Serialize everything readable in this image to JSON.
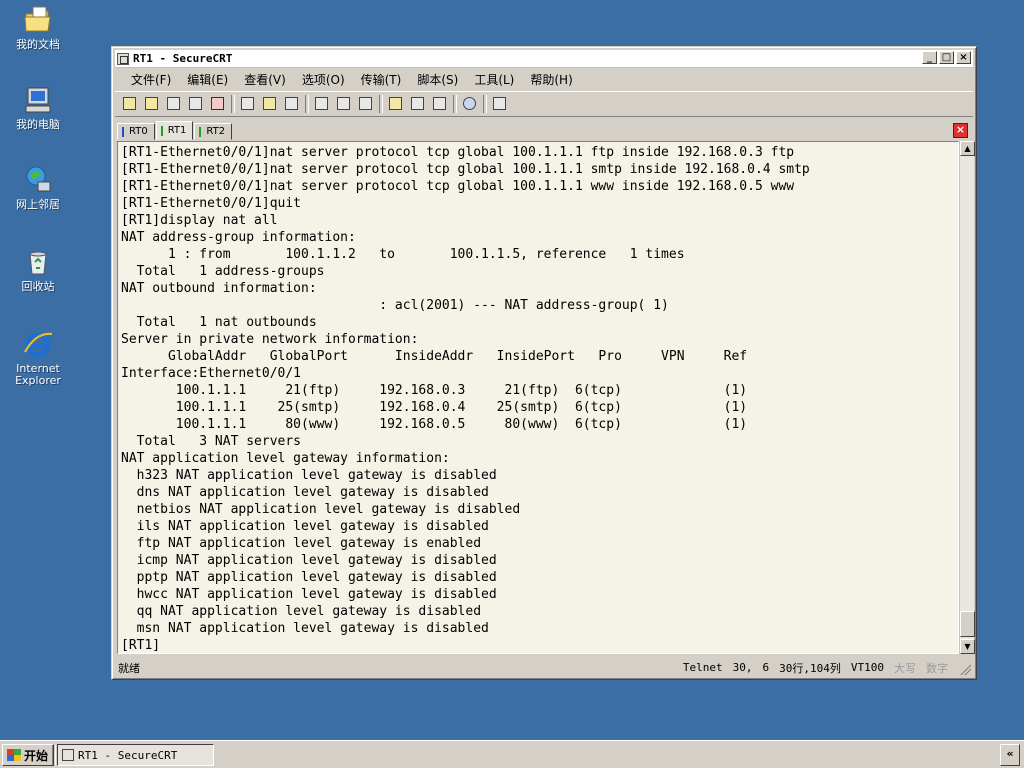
{
  "desktop": {
    "icons": [
      {
        "label": "我的文档",
        "icon": "folder-documents-icon"
      },
      {
        "label": "我的电脑",
        "icon": "computer-icon"
      },
      {
        "label": "网上邻居",
        "icon": "network-icon"
      },
      {
        "label": "回收站",
        "icon": "recycle-bin-icon"
      },
      {
        "label": "Internet Explorer",
        "icon": "internet-explorer-icon"
      }
    ]
  },
  "window": {
    "title": "RT1 - SecureCRT",
    "controls": {
      "minimize": "_",
      "maximize": "□",
      "close": "×"
    },
    "menu": [
      "文件(F)",
      "编辑(E)",
      "查看(V)",
      "选项(O)",
      "传输(T)",
      "脚本(S)",
      "工具(L)",
      "帮助(H)"
    ],
    "tabs": [
      {
        "label": "RT0",
        "color": "#2a4ac0"
      },
      {
        "label": "RT1",
        "color": "#20a020"
      },
      {
        "label": "RT2",
        "color": "#20a020"
      }
    ],
    "active_tab": "RT1",
    "tab_close": "×"
  },
  "terminal": {
    "lines": [
      "[RT1-Ethernet0/0/1]nat server protocol tcp global 100.1.1.1 ftp inside 192.168.0.3 ftp",
      "[RT1-Ethernet0/0/1]nat server protocol tcp global 100.1.1.1 smtp inside 192.168.0.4 smtp",
      "[RT1-Ethernet0/0/1]nat server protocol tcp global 100.1.1.1 www inside 192.168.0.5 www",
      "[RT1-Ethernet0/0/1]quit",
      "[RT1]display nat all",
      "NAT address-group information:",
      "      1 : from       100.1.1.2   to       100.1.1.5, reference   1 times",
      "  Total   1 address-groups",
      "NAT outbound information:",
      "                                 : acl(2001) --- NAT address-group( 1)",
      "  Total   1 nat outbounds",
      "Server in private network information:",
      "      GlobalAddr   GlobalPort      InsideAddr   InsidePort   Pro     VPN     Ref",
      "Interface:Ethernet0/0/1",
      "       100.1.1.1     21(ftp)     192.168.0.3     21(ftp)  6(tcp)             (1)",
      "       100.1.1.1    25(smtp)     192.168.0.4    25(smtp)  6(tcp)             (1)",
      "       100.1.1.1     80(www)     192.168.0.5     80(www)  6(tcp)             (1)",
      "  Total   3 NAT servers",
      "NAT application level gateway information:",
      "  h323 NAT application level gateway is disabled",
      "  dns NAT application level gateway is disabled",
      "  netbios NAT application level gateway is disabled",
      "  ils NAT application level gateway is disabled",
      "  ftp NAT application level gateway is enabled",
      "  icmp NAT application level gateway is disabled",
      "  pptp NAT application level gateway is disabled",
      "  hwcc NAT application level gateway is disabled",
      "  qq NAT application level gateway is disabled",
      "  msn NAT application level gateway is disabled",
      "[RT1]"
    ]
  },
  "statusbar": {
    "ready": "就绪",
    "protocol": "Telnet",
    "row": "30,",
    "col": "6",
    "size": "30行,104列",
    "emulation": "VT100",
    "caps": "大写",
    "num": "数字"
  },
  "taskbar": {
    "start_label": "开始",
    "task_title": "RT1 - SecureCRT",
    "tray_toggle": "«"
  }
}
